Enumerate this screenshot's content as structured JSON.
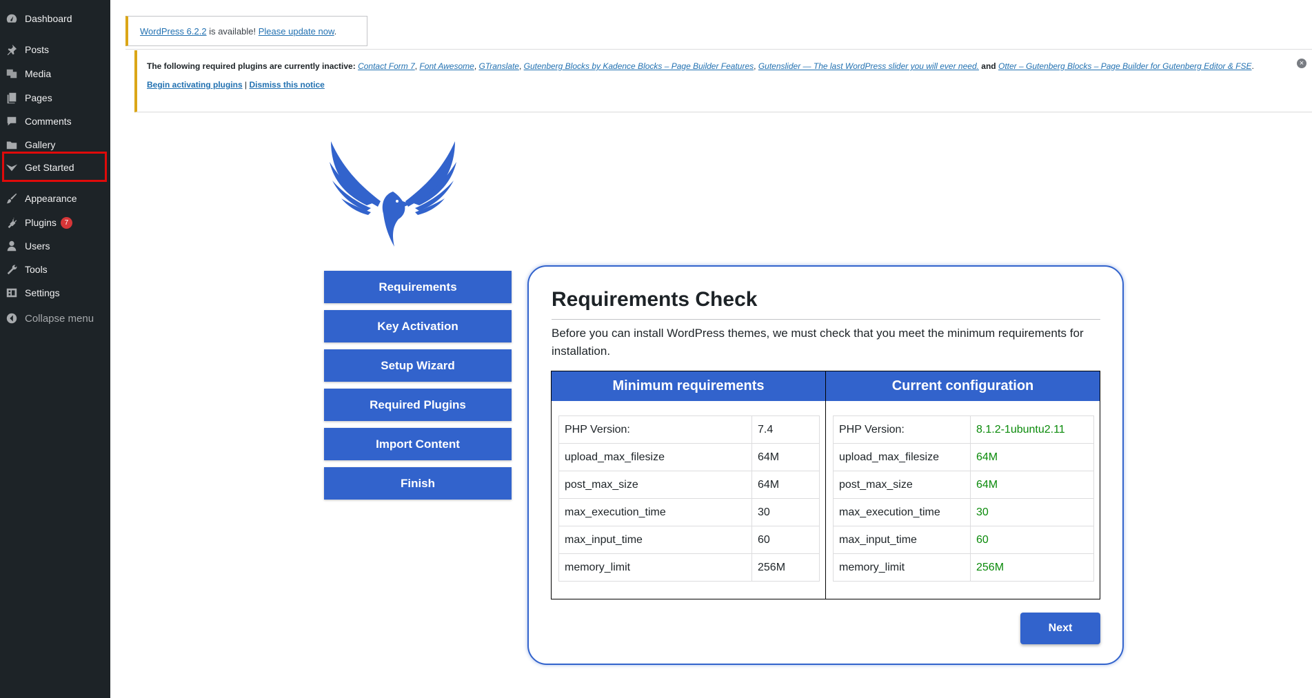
{
  "sidebar": {
    "items": [
      {
        "label": "Dashboard",
        "icon": "dashboard-icon"
      },
      {
        "label": "Posts",
        "icon": "pin-icon"
      },
      {
        "label": "Media",
        "icon": "media-icon"
      },
      {
        "label": "Pages",
        "icon": "pages-icon"
      },
      {
        "label": "Comments",
        "icon": "comment-icon"
      },
      {
        "label": "Gallery",
        "icon": "folder-icon"
      },
      {
        "label": "Get Started",
        "icon": "chevron-logo-icon"
      },
      {
        "label": "Appearance",
        "icon": "brush-icon"
      },
      {
        "label": "Plugins",
        "icon": "plug-icon",
        "badge": "7"
      },
      {
        "label": "Users",
        "icon": "user-icon"
      },
      {
        "label": "Tools",
        "icon": "wrench-icon"
      },
      {
        "label": "Settings",
        "icon": "settings-icon"
      },
      {
        "label": "Collapse menu",
        "icon": "collapse-icon"
      }
    ],
    "highlighted": "Get Started"
  },
  "notices": {
    "update": {
      "link": "WordPress 6.2.2",
      "text": " is available! ",
      "action": "Please update now",
      "end": "."
    },
    "plugins": {
      "intro": "The following required plugins are currently inactive:",
      "plugins": [
        "Contact Form 7",
        "Font Awesome",
        "GTranslate",
        "Gutenberg Blocks by Kadence Blocks – Page Builder Features",
        "Gutenslider — The last WordPress slider you will ever need.",
        "Otter – Gutenberg Blocks – Page Builder for Gutenberg Editor & FSE"
      ],
      "sep": ", ",
      "and": " and ",
      "end": ".",
      "activate": "Begin activating plugins",
      "divider": " | ",
      "dismiss": "Dismiss this notice"
    }
  },
  "steps": [
    "Requirements",
    "Key Activation",
    "Setup Wizard",
    "Required Plugins",
    "Import Content",
    "Finish"
  ],
  "card": {
    "title": "Requirements Check",
    "description": "Before you can install WordPress themes, we must check that you meet the minimum requirements for installation.",
    "min_header": "Minimum requirements",
    "current_header": "Current configuration",
    "rows": [
      {
        "name": "PHP Version:",
        "min": "7.4",
        "current": "8.1.2-1ubuntu2.11"
      },
      {
        "name": "upload_max_filesize",
        "min": "64M",
        "current": "64M"
      },
      {
        "name": "post_max_size",
        "min": "64M",
        "current": "64M"
      },
      {
        "name": "max_execution_time",
        "min": "30",
        "current": "30"
      },
      {
        "name": "max_input_time",
        "min": "60",
        "current": "60"
      },
      {
        "name": "memory_limit",
        "min": "256M",
        "current": "256M"
      }
    ],
    "next": "Next"
  },
  "colors": {
    "accent": "#3263cc",
    "sidebar": "#1d2327",
    "ok": "#0a8a0a",
    "warning": "#dba617"
  }
}
